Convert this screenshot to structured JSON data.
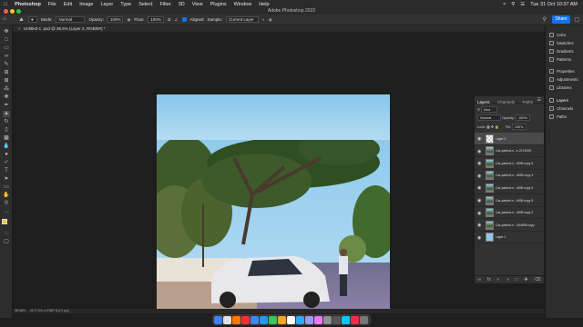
{
  "menubar": {
    "apple_icon": "apple-icon",
    "app": "Photoshop",
    "items": [
      "File",
      "Edit",
      "Image",
      "Layer",
      "Type",
      "Select",
      "Filter",
      "3D",
      "View",
      "Plugins",
      "Window",
      "Help"
    ],
    "datetime": "Tue 31 Oct 10:37 AM"
  },
  "window": {
    "title": "Adobe Photoshop 2022"
  },
  "options": {
    "mode_label": "Mode:",
    "mode_value": "Normal",
    "opacity_label": "Opacity:",
    "opacity_value": "100%",
    "flow_label": "Flow:",
    "flow_value": "100%",
    "aligned_label": "Aligned",
    "sample_label": "Sample:",
    "sample_value": "Current Layer",
    "share_label": "Share"
  },
  "document": {
    "tab_title": "Untitled-1 .psd @ 38.5% (Layer 2, RGB/8#) *",
    "zoom": "38.46%",
    "doc_info": "2177 ft in x 9\"887 ft (72 ppi)"
  },
  "layers_panel": {
    "tabs": [
      "Layers",
      "Channels",
      "Paths"
    ],
    "kind_label": "Kind",
    "blend_mode": "Normal",
    "opacity_label": "Opacity:",
    "opacity_value": "100%",
    "lock_label": "Lock:",
    "fill_label": "Fill:",
    "fill_value": "100%",
    "layers": [
      {
        "name": "Layer 2",
        "type": "transparent"
      },
      {
        "name": "Car-parked-n...e-2174399",
        "type": "photo"
      },
      {
        "name": "Car-parked-n...4696 copy 5",
        "type": "photo"
      },
      {
        "name": "Car-parked-n...4696 copy 4",
        "type": "photo"
      },
      {
        "name": "Car-parked-n...4696 copy 3",
        "type": "photo"
      },
      {
        "name": "Car-parked-n...4696 copy 5",
        "type": "photo"
      },
      {
        "name": "Car-parked-n...4696 copy 2",
        "type": "photo"
      },
      {
        "name": "Car-parked-n...2A4696 copy",
        "type": "photo"
      },
      {
        "name": "Layer 1",
        "type": "sky"
      }
    ]
  },
  "right_dock": {
    "group1": [
      "Color",
      "Swatches",
      "Gradients",
      "Patterns"
    ],
    "group2": [
      "Properties",
      "Adjustments",
      "Libraries"
    ],
    "group3": [
      "Layers",
      "Channels",
      "Paths"
    ]
  },
  "colors": {
    "accent": "#1473e6",
    "sky": "#8fc9ea",
    "bg": "#1e1e1e"
  }
}
